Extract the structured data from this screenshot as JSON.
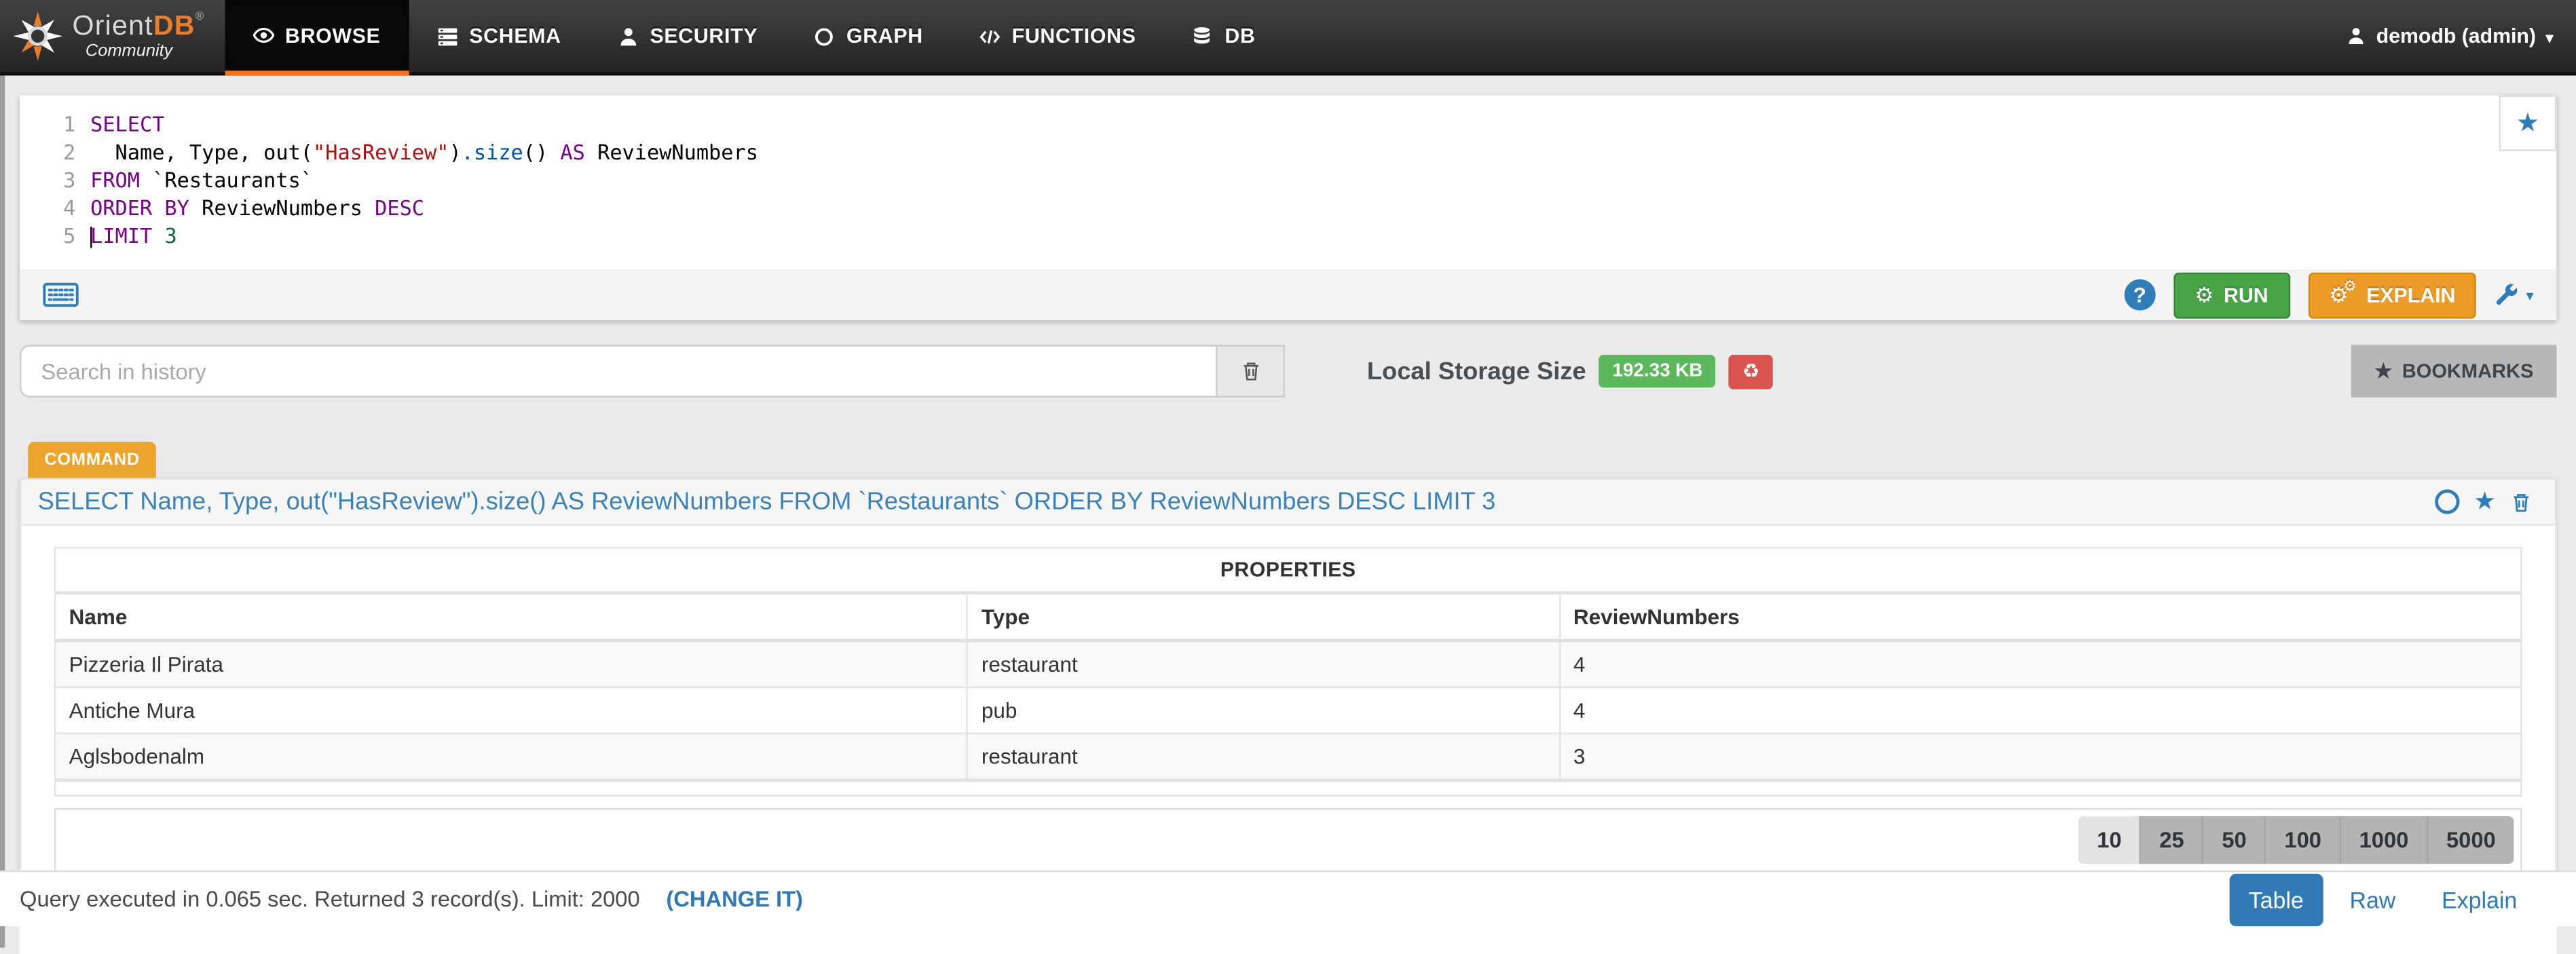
{
  "nav": {
    "logo": {
      "brand1": "Orient",
      "brand2": "DB",
      "reg": "®",
      "subtitle": "Community"
    },
    "items": [
      {
        "label": "BROWSE",
        "active": true
      },
      {
        "label": "SCHEMA",
        "active": false
      },
      {
        "label": "SECURITY",
        "active": false
      },
      {
        "label": "GRAPH",
        "active": false
      },
      {
        "label": "FUNCTIONS",
        "active": false
      },
      {
        "label": "DB",
        "active": false
      }
    ],
    "user": {
      "label": "demodb (admin)",
      "caret": "▾"
    }
  },
  "editor": {
    "bookmark_icon": "★",
    "lines": [
      {
        "num": "1",
        "segments": [
          {
            "t": "SELECT"
          }
        ]
      },
      {
        "num": "2",
        "segments": [
          {
            "t": "  Name, Type, out("
          },
          {
            "t": "\"HasReview\""
          },
          {
            "t": ")"
          },
          {
            "t": ".size"
          },
          {
            "t": "() "
          },
          {
            "t": "AS"
          },
          {
            "t": " ReviewNumbers"
          }
        ]
      },
      {
        "num": "3",
        "segments": [
          {
            "t": "FROM"
          },
          {
            "t": " `Restaurants`"
          }
        ]
      },
      {
        "num": "4",
        "segments": [
          {
            "t": "ORDER BY"
          },
          {
            "t": " ReviewNumbers "
          },
          {
            "t": "DESC"
          }
        ]
      },
      {
        "num": "5",
        "segments": [
          {
            "t": "LIMIT"
          },
          {
            "t": " "
          },
          {
            "t": "3"
          }
        ]
      }
    ]
  },
  "toolbar": {
    "help_label": "?",
    "run_label": "RUN",
    "explain_label": "EXPLAIN",
    "gear_icon": "⚙",
    "wrench_caret": "▾"
  },
  "history": {
    "search_placeholder": "Search in history",
    "storage_label": "Local Storage Size",
    "storage_size": "192.33 KB",
    "reset_icon": "♻",
    "bookmarks_icon": "★",
    "bookmarks_label": "BOOKMARKS",
    "item": {
      "badge": "COMMAND",
      "query": "SELECT Name, Type, out(\"HasReview\").size() AS ReviewNumbers FROM `Restaurants` ORDER BY ReviewNumbers DESC LIMIT 3",
      "star_icon": "★"
    }
  },
  "results": {
    "table_caption": "PROPERTIES",
    "columns": [
      "Name",
      "Type",
      "ReviewNumbers"
    ],
    "rows": [
      [
        "Pizzeria Il Pirata",
        "restaurant",
        "4"
      ],
      [
        "Antiche Mura",
        "pub",
        "4"
      ],
      [
        "Aglsbodenalm",
        "restaurant",
        "3"
      ]
    ],
    "page_sizes": [
      "10",
      "25",
      "50",
      "100",
      "1000",
      "5000"
    ],
    "active_page_size": "10",
    "status_text": "Query executed in 0.065 sec. Returned 3 record(s). Limit: 2000",
    "change_it": "(CHANGE IT)",
    "view_tabs": [
      "Table",
      "Raw",
      "Explain"
    ],
    "active_view": "Table"
  },
  "colors": {
    "accent_blue": "#2e7cb8",
    "run_green": "#47a447",
    "explain_orange": "#ed9c28",
    "badge_green": "#5cb85c",
    "reset_red": "#d9534f",
    "nav_orange": "#ef7522",
    "keyword_purple": "#770088",
    "string_red": "#aa1111",
    "number_green": "#116644"
  }
}
